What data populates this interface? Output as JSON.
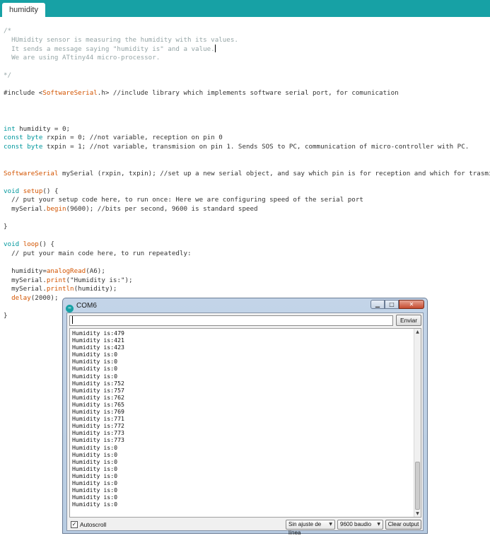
{
  "tab": {
    "label": "humidity"
  },
  "code_lines": [
    [
      {
        "t": "/*",
        "c": "cmt"
      }
    ],
    [
      {
        "t": "  HUmidity sensor is measuring the humidity with its values.",
        "c": "cmt"
      }
    ],
    [
      {
        "t": "  It sends a message saying \"humidity is\" and a value.",
        "c": "cmt"
      }
    ],
    [
      {
        "t": "  We are using ATtiny44 micro-processor.",
        "c": "cmt"
      }
    ],
    [],
    [
      {
        "t": "*/",
        "c": "cmt"
      }
    ],
    [],
    [
      {
        "t": "#include <",
        "c": ""
      },
      {
        "t": "SoftwareSerial",
        "c": "fn"
      },
      {
        "t": ".h> //include library which implements software serial port, for comunication",
        "c": ""
      }
    ],
    [],
    [],
    [],
    [
      {
        "t": "int",
        "c": "kw"
      },
      {
        "t": " humidity = 0;",
        "c": ""
      }
    ],
    [
      {
        "t": "const",
        "c": "kw"
      },
      {
        "t": " ",
        "c": ""
      },
      {
        "t": "byte",
        "c": "kw"
      },
      {
        "t": " rxpin = 0; //not variable, reception on pin 0",
        "c": ""
      }
    ],
    [
      {
        "t": "const",
        "c": "kw"
      },
      {
        "t": " ",
        "c": ""
      },
      {
        "t": "byte",
        "c": "kw"
      },
      {
        "t": " txpin = 1; //not variable, transmision on pin 1. Sends SOS to PC, communication of micro-controller with PC.",
        "c": ""
      }
    ],
    [],
    [],
    [
      {
        "t": "SoftwareSerial",
        "c": "fn"
      },
      {
        "t": " mySerial (rxpin, txpin); //set up a new serial object, and say which pin is for reception and which for trasmision",
        "c": ""
      }
    ],
    [],
    [
      {
        "t": "void",
        "c": "kw"
      },
      {
        "t": " ",
        "c": ""
      },
      {
        "t": "setup",
        "c": "fn"
      },
      {
        "t": "() {",
        "c": ""
      }
    ],
    [
      {
        "t": "  // put your setup code here, to run once: Here we are configuring speed of the serial port",
        "c": ""
      }
    ],
    [
      {
        "t": "  mySerial.",
        "c": ""
      },
      {
        "t": "begin",
        "c": "fn"
      },
      {
        "t": "(9600); //bits per second, 9600 is standard speed",
        "c": ""
      }
    ],
    [],
    [
      {
        "t": "}",
        "c": ""
      }
    ],
    [],
    [
      {
        "t": "void",
        "c": "kw"
      },
      {
        "t": " ",
        "c": ""
      },
      {
        "t": "loop",
        "c": "fn"
      },
      {
        "t": "() {",
        "c": ""
      }
    ],
    [
      {
        "t": "  // put your main code here, to run repeatedly:",
        "c": ""
      }
    ],
    [],
    [
      {
        "t": "  humidity=",
        "c": ""
      },
      {
        "t": "analogRead",
        "c": "fn"
      },
      {
        "t": "(A6);",
        "c": ""
      }
    ],
    [
      {
        "t": "  mySerial.",
        "c": ""
      },
      {
        "t": "print",
        "c": "fn"
      },
      {
        "t": "(\"Humidity is:\");",
        "c": ""
      }
    ],
    [
      {
        "t": "  mySerial.",
        "c": ""
      },
      {
        "t": "println",
        "c": "fn"
      },
      {
        "t": "(humidity);",
        "c": ""
      }
    ],
    [
      {
        "t": "  ",
        "c": ""
      },
      {
        "t": "delay",
        "c": "fn"
      },
      {
        "t": "(2000);",
        "c": ""
      }
    ],
    [],
    [
      {
        "t": "}",
        "c": ""
      }
    ]
  ],
  "serial_monitor": {
    "title": "COM6",
    "input_value": "",
    "send_label": "Enviar",
    "output_lines": [
      "Humidity is:479",
      "Humidity is:421",
      "Humidity is:423",
      "Humidity is:0",
      "Humidity is:0",
      "Humidity is:0",
      "Humidity is:0",
      "Humidity is:752",
      "Humidity is:757",
      "Humidity is:762",
      "Humidity is:765",
      "Humidity is:769",
      "Humidity is:771",
      "Humidity is:772",
      "Humidity is:773",
      "Humidity is:773",
      "Humidity is:0",
      "Humidity is:0",
      "Humidity is:0",
      "Humidity is:0",
      "Humidity is:0",
      "Humidity is:0",
      "Humidity is:0",
      "Humidity is:0",
      "Humidity is:0"
    ],
    "autoscroll_label": "Autoscroll",
    "autoscroll_checked": true,
    "line_ending": "Sin ajuste de línea",
    "baud_rate": "9600 baudio",
    "clear_label": "Clear output"
  },
  "colors": {
    "tabbar": "#17a1a5",
    "comment": "#95a5a6",
    "keyword": "#00979c",
    "function": "#d35400"
  },
  "icons": {
    "window_icon": "arduino-icon",
    "minimize": "minimize-icon",
    "maximize": "maximize-icon",
    "close": "close-icon"
  }
}
